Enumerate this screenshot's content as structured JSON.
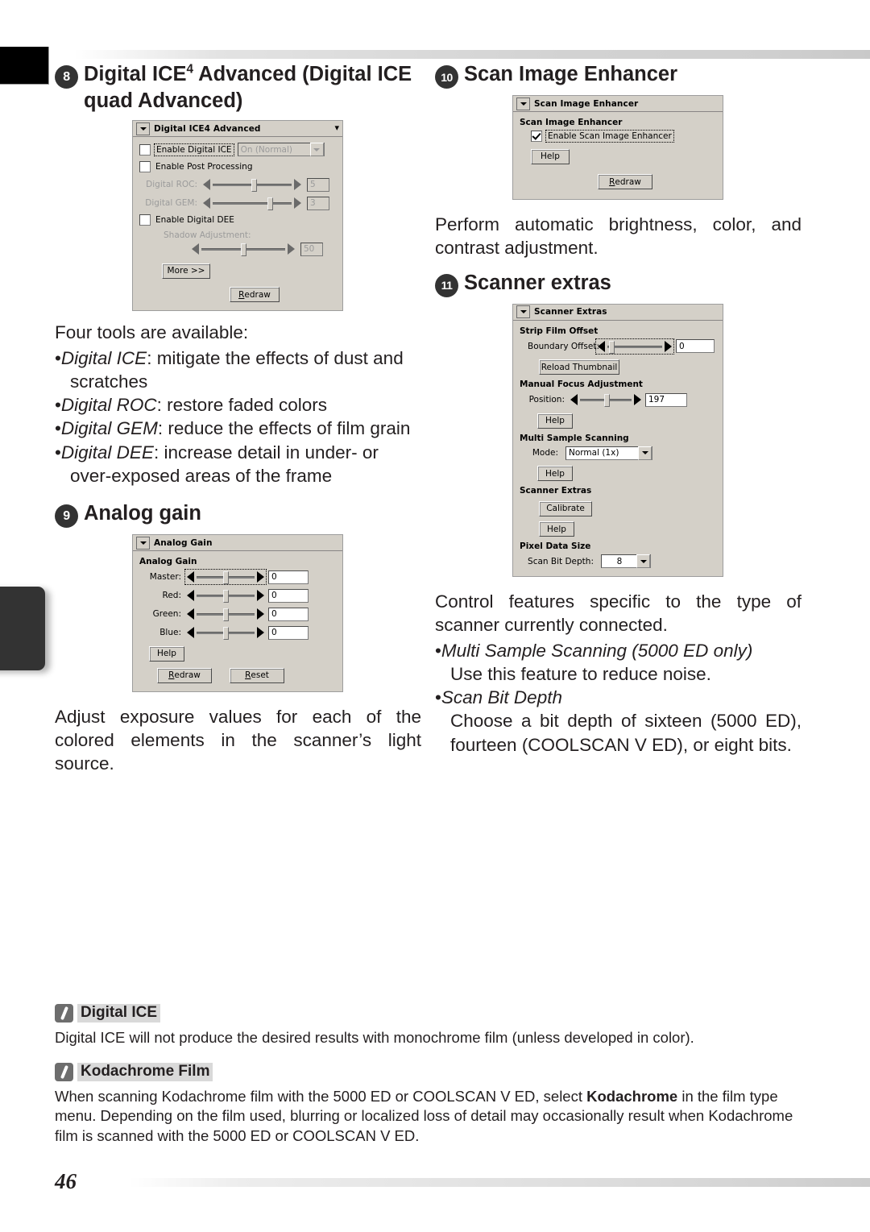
{
  "page": {
    "number": "46"
  },
  "left_column": {
    "section8": {
      "badge": "8",
      "title_line1": "Digital ICE",
      "title_sup": "4",
      "title_line1b": " Advanced (Digital ICE",
      "title_line2": "quad Advanced)",
      "dialog": {
        "title": "Digital ICE4 Advanced",
        "checkbox_ice": "Enable Digital ICE",
        "combo_ice_value": "On (Normal)",
        "checkbox_post": "Enable Post Processing",
        "slider_roc_label": "Digital ROC:",
        "slider_roc_value": "5",
        "slider_gem_label": "Digital GEM:",
        "slider_gem_value": "3",
        "checkbox_dee": "Enable Digital DEE",
        "slider_shadow_label": "Shadow Adjustment:",
        "slider_shadow_value": "50",
        "button_more": "More >>",
        "button_redraw": "Redraw"
      },
      "intro": "Four tools are available:",
      "bullets": [
        {
          "term": "Digital ICE",
          "text": ": mitigate the effects of dust and scratches"
        },
        {
          "term": "Digital ROC",
          "text": ": restore faded colors"
        },
        {
          "term": "Digital GEM",
          "text": ": reduce the effects of film grain"
        },
        {
          "term": "Digital DEE",
          "text": ": increase detail in under- or over-exposed areas of the frame"
        }
      ]
    },
    "section9": {
      "badge": "9",
      "title": "Analog gain",
      "dialog": {
        "title": "Analog Gain",
        "group_label": "Analog Gain",
        "rows": [
          {
            "label": "Master:",
            "value": "0"
          },
          {
            "label": "Red:",
            "value": "0"
          },
          {
            "label": "Green:",
            "value": "0"
          },
          {
            "label": "Blue:",
            "value": "0"
          }
        ],
        "button_help": "Help",
        "button_redraw": "Redraw",
        "button_reset": "Reset"
      },
      "paragraph": "Adjust exposure values for each of the colored elements in the scanner’s light source."
    }
  },
  "right_column": {
    "section10": {
      "badge": "10",
      "title": "Scan Image Enhancer",
      "dialog": {
        "title": "Scan Image Enhancer",
        "group_label": "Scan Image Enhancer",
        "checkbox_label": "Enable Scan Image Enhancer",
        "button_help": "Help",
        "button_redraw": "Redraw"
      },
      "paragraph": "Perform automatic brightness, color, and contrast adjustment."
    },
    "section11": {
      "badge": "11",
      "title": "Scanner extras",
      "dialog": {
        "title": "Scanner Extras",
        "group_strip": "Strip Film Offset",
        "boundary_label": "Boundary Offset:",
        "boundary_value": "0",
        "button_reload": "Reload Thumbnail",
        "group_focus": "Manual Focus Adjustment",
        "position_label": "Position:",
        "position_value": "197",
        "button_help_focus": "Help",
        "group_multi": "Multi Sample Scanning",
        "mode_label": "Mode:",
        "mode_value": "Normal (1x)",
        "button_help_multi": "Help",
        "group_extras": "Scanner Extras",
        "button_calibrate": "Calibrate",
        "button_help_extras": "Help",
        "group_pixel": "Pixel Data Size",
        "bitdepth_label": "Scan Bit Depth:",
        "bitdepth_value": "8"
      },
      "paragraph": "Control features specific to the type of scanner currently connected.",
      "bullets": [
        {
          "term": "Multi Sample Scanning (5000 ED only)",
          "text": "Use this feature to reduce noise."
        },
        {
          "term": "Scan Bit Depth",
          "text": "Choose a bit depth of sixteen (5000 ED), fourteen (COOLSCAN V ED), or eight bits."
        }
      ]
    }
  },
  "tips": [
    {
      "title": "Digital ICE",
      "body_parts": [
        {
          "text": "Digital ICE will not produce the desired results with monochrome film (unless developed in color).",
          "bold": false
        }
      ]
    },
    {
      "title": "Kodachrome Film",
      "body_parts": [
        {
          "text": "When scanning Kodachrome film with the 5000 ED or COOLSCAN V ED, select ",
          "bold": false
        },
        {
          "text": "Kodachrome",
          "bold": true
        },
        {
          "text": " in the film type menu. Depending on the film used, blurring or localized loss of detail may occasionally result when Kodachrome film is scanned with the 5000 ED or COOLSCAN V ED.",
          "bold": false
        }
      ]
    }
  ]
}
